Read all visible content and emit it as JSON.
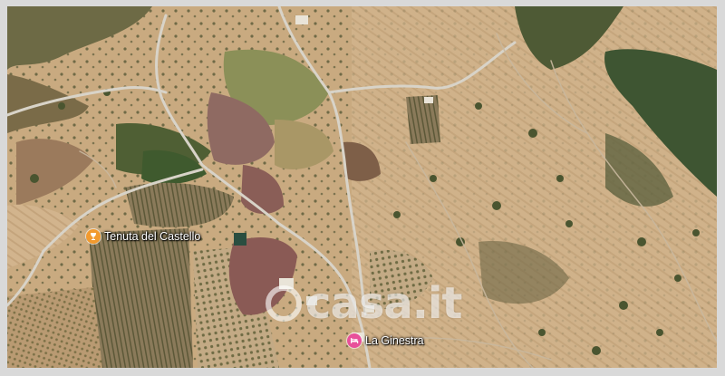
{
  "map": {
    "view": "satellite"
  },
  "pois": [
    {
      "label": "Tenuta del Castello",
      "icon": "wine-glass-icon",
      "color": "#f29a2e"
    },
    {
      "label": "La Ginestra",
      "icon": "hotel-bed-icon",
      "color": "#e8509a"
    }
  ],
  "watermark": {
    "text": "casa.it"
  }
}
